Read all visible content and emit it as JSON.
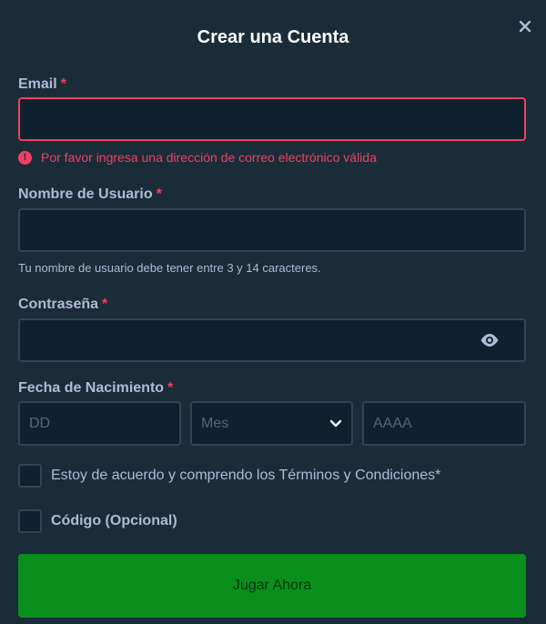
{
  "modal": {
    "title": "Crear una Cuenta",
    "close_icon": "close-icon"
  },
  "email": {
    "label": "Email",
    "required_mark": "*",
    "value": "",
    "placeholder": "",
    "error": "Por favor ingresa una dirección de correo electrónico válida",
    "error_icon_glyph": "!"
  },
  "username": {
    "label": "Nombre de Usuario",
    "required_mark": "*",
    "value": "",
    "hint": "Tu nombre de usuario debe tener entre 3 y 14 caracteres."
  },
  "password": {
    "label": "Contraseña",
    "required_mark": "*",
    "value": "",
    "toggle_icon": "eye-icon"
  },
  "birthdate": {
    "label": "Fecha de Nacimiento",
    "required_mark": "*",
    "day_placeholder": "DD",
    "month_placeholder": "Mes",
    "year_placeholder": "AAAA"
  },
  "terms": {
    "label": "Estoy de acuerdo y comprendo los Términos y Condiciones*",
    "checked": false
  },
  "code": {
    "label": "Código (Opcional)",
    "checked": false
  },
  "submit": {
    "label": "Jugar Ahora"
  },
  "colors": {
    "background": "#1a2c38",
    "input_bg": "#0f212e",
    "border": "#2f4553",
    "error": "#ed4163",
    "primary_green": "#0a8f1d",
    "text": "#b1bad3"
  }
}
